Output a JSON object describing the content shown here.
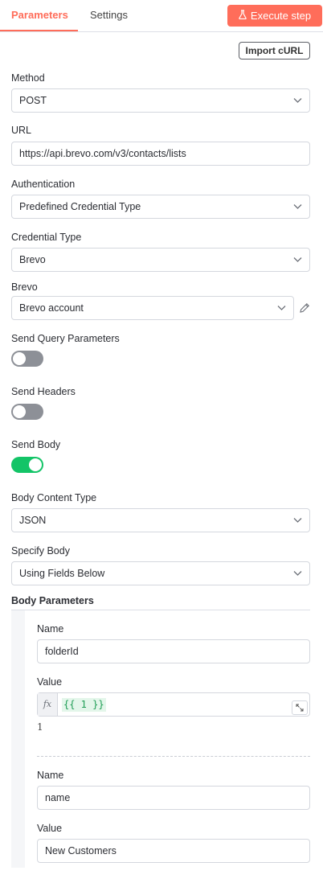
{
  "tabs": {
    "parameters": "Parameters",
    "settings": "Settings"
  },
  "execute_button": "Execute step",
  "import_button": "Import cURL",
  "method": {
    "label": "Method",
    "value": "POST"
  },
  "url": {
    "label": "URL",
    "value": "https://api.brevo.com/v3/contacts/lists"
  },
  "authentication": {
    "label": "Authentication",
    "value": "Predefined Credential Type"
  },
  "credential_type": {
    "label": "Credential Type",
    "value": "Brevo"
  },
  "brevo": {
    "label": "Brevo",
    "value": "Brevo account"
  },
  "send_query": {
    "label": "Send Query Parameters",
    "enabled": false
  },
  "send_headers": {
    "label": "Send Headers",
    "enabled": false
  },
  "send_body": {
    "label": "Send Body",
    "enabled": true
  },
  "body_content_type": {
    "label": "Body Content Type",
    "value": "JSON"
  },
  "specify_body": {
    "label": "Specify Body",
    "value": "Using Fields Below"
  },
  "body_parameters": {
    "title": "Body Parameters",
    "params": [
      {
        "name_label": "Name",
        "name": "folderId",
        "value_label": "Value",
        "value_expression": "{{ 1 }}",
        "value_result": "1",
        "fx": "fx"
      },
      {
        "name_label": "Name",
        "name": "name",
        "value_label": "Value",
        "value": "New Customers"
      }
    ]
  },
  "colors": {
    "accent": "#ff6d5a",
    "toggle_on": "#13c467",
    "toggle_off": "#8d9097"
  }
}
